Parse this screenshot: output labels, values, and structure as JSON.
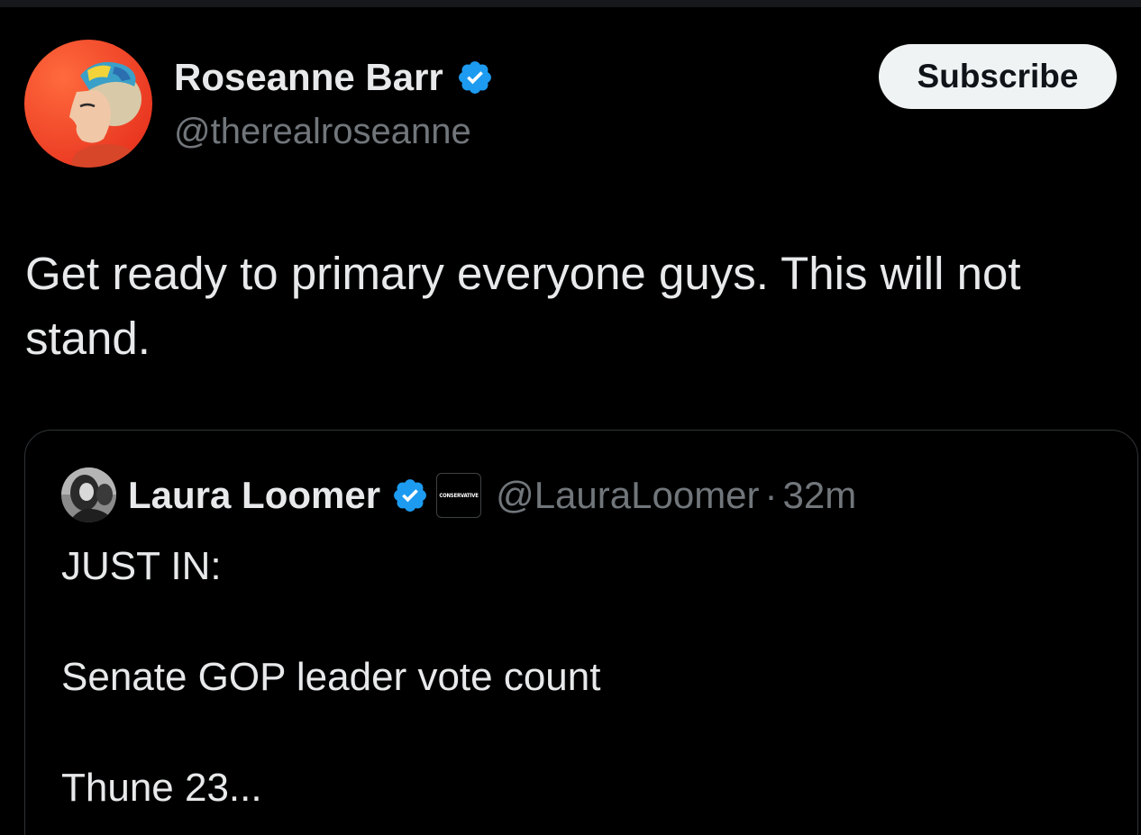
{
  "tweet": {
    "author_name": "Roseanne Barr",
    "author_handle": "@therealroseanne",
    "subscribe_label": "Subscribe",
    "text": "Get ready to primary everyone guys. This will not stand."
  },
  "quoted_tweet": {
    "author_name": "Laura Loomer",
    "affiliate_badge_text": "CONSERVATIVE",
    "author_handle": "@LauraLoomer",
    "separator": "·",
    "time": "32m",
    "lines": [
      "JUST IN:",
      "Senate GOP leader vote count",
      "Thune 23..."
    ]
  },
  "icons": {
    "verified": "verified-badge-icon",
    "avatar": "avatar-photo",
    "affiliate": "affiliate-badge-icon"
  },
  "colors": {
    "background": "#000000",
    "text_primary": "#e7e9ea",
    "text_secondary": "#71767b",
    "verified_blue": "#1d9bf0",
    "border": "#2f3336",
    "subscribe_bg": "#eff3f4",
    "subscribe_text": "#0f1419"
  }
}
